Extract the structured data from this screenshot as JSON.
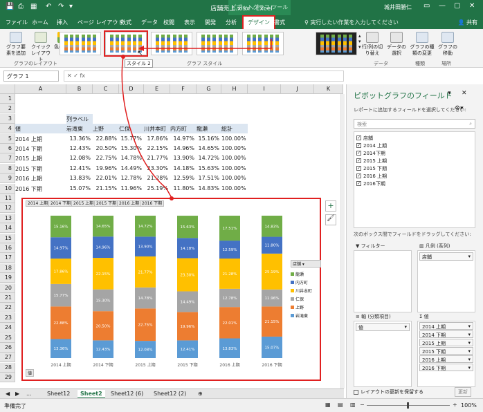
{
  "titlebar": {
    "title": "店舗売上.xlsx - Excel",
    "context_tool": "ピボットグラフ ツール",
    "user": "城井田勝仁"
  },
  "tabs": [
    "ファイル",
    "ホーム",
    "挿入",
    "ページ レイアウト",
    "数式",
    "データ",
    "校閲",
    "表示",
    "開発",
    "分析",
    "デザイン",
    "書式"
  ],
  "tellme": "実行したい作業を入力してください",
  "share": "共有",
  "ribbon": {
    "add_element": "グラフ要素を追加",
    "quick_layout": "クイックレイアウト",
    "change_color": "色の変更",
    "switch_row_col": "行/列の切り替え",
    "select_data": "データの選択",
    "change_type": "グラフの種類の変更",
    "move_chart": "グラフの移動",
    "group_layout": "グラフのレイアウト",
    "group_style": "グラフ スタイル",
    "group_data": "データ",
    "group_type": "種類",
    "group_location": "場所",
    "tooltip": "スタイル 2"
  },
  "namebox": "グラフ 1",
  "columns": [
    "A",
    "B",
    "C",
    "D",
    "E",
    "F",
    "G",
    "H",
    "I",
    "J",
    "K"
  ],
  "rows": [
    "1",
    "2",
    "3",
    "4",
    "5",
    "6",
    "7",
    "8",
    "9",
    "10",
    "11",
    "12",
    "13",
    "14",
    "15",
    "16",
    "17",
    "18",
    "19",
    "20",
    "21",
    "22",
    "23",
    "24",
    "25",
    "26",
    "27",
    "28",
    "29"
  ],
  "pivot": {
    "col_label": "列ラベル",
    "value_header": "値",
    "headers": [
      "岩滝東",
      "上野",
      "仁保",
      "川井本町",
      "内方町",
      "龍瀬",
      "総計"
    ],
    "rows": [
      {
        "label": "2014 上期",
        "values": [
          "13.36%",
          "22.88%",
          "15.77%",
          "17.86%",
          "14.97%",
          "15.16%",
          "100.00%"
        ]
      },
      {
        "label": "2014 下期",
        "values": [
          "12.43%",
          "20.50%",
          "15.30%",
          "22.15%",
          "14.96%",
          "14.65%",
          "100.00%"
        ]
      },
      {
        "label": "2015 上期",
        "values": [
          "12.08%",
          "22.75%",
          "14.78%",
          "21.77%",
          "13.90%",
          "14.72%",
          "100.00%"
        ]
      },
      {
        "label": "2015 下期",
        "values": [
          "12.41%",
          "19.96%",
          "14.49%",
          "23.30%",
          "14.18%",
          "15.63%",
          "100.00%"
        ]
      },
      {
        "label": "2016 上期",
        "values": [
          "13.83%",
          "22.01%",
          "12.78%",
          "21.28%",
          "12.59%",
          "17.51%",
          "100.00%"
        ]
      },
      {
        "label": "2016 下期",
        "values": [
          "15.07%",
          "21.15%",
          "11.96%",
          "25.19%",
          "11.80%",
          "14.83%",
          "100.00%"
        ]
      }
    ]
  },
  "chart_data": {
    "type": "bar",
    "stacked": "percent",
    "categories": [
      "2014 上期",
      "2014 下期",
      "2015 上期",
      "2015 下期",
      "2016 上期",
      "2016 下期"
    ],
    "series": [
      {
        "name": "岩滝東",
        "color": "#5b9bd5",
        "values": [
          13.36,
          12.43,
          12.08,
          12.41,
          13.83,
          15.07
        ]
      },
      {
        "name": "上野",
        "color": "#ed7d31",
        "values": [
          22.88,
          20.5,
          22.75,
          19.96,
          22.01,
          21.15
        ]
      },
      {
        "name": "仁保",
        "color": "#a5a5a5",
        "values": [
          15.77,
          15.3,
          14.78,
          14.49,
          12.78,
          11.96
        ]
      },
      {
        "name": "川井本町",
        "color": "#ffc000",
        "values": [
          17.86,
          22.15,
          21.77,
          23.3,
          21.28,
          25.19
        ]
      },
      {
        "name": "内方町",
        "color": "#4472c4",
        "values": [
          14.97,
          14.96,
          13.9,
          14.18,
          12.59,
          11.8
        ]
      },
      {
        "name": "龍瀬",
        "color": "#70ad47",
        "values": [
          15.16,
          14.65,
          14.72,
          15.63,
          17.51,
          14.83
        ]
      }
    ],
    "legend_title": "店舗",
    "legend_position": "right",
    "filter_label": "値",
    "grid": false
  },
  "field_buttons": [
    "2014 上期",
    "2014 下期",
    "2015 上期",
    "2015 下期",
    "2016 上期",
    "2016 下期"
  ],
  "pane": {
    "title": "ピボットグラフのフィールド",
    "subtitle": "レポートに追加するフィールドを選択してください:",
    "search": "検索",
    "fields": [
      "店舗",
      "2014 上期",
      "2014下期",
      "2015 上期",
      "2015 下期",
      "2016 上期",
      "2016下期"
    ],
    "drag_hint": "次のボックス間でフィールドをドラッグしてください:",
    "filter_area": "フィルター",
    "legend_area": "凡例 (系列)",
    "legend_item": "店舗",
    "axis_area": "軸 (分類項目)",
    "axis_item": "値",
    "values_area": "値",
    "values_items": [
      "2014 上期",
      "2014 下期",
      "2015 上期",
      "2015 下期",
      "2016 上期",
      "2016 下期"
    ],
    "defer": "レイアウトの更新を保留する",
    "update": "更新"
  },
  "sheets": [
    "Sheet12",
    "Sheet2",
    "Sheet12 (6)",
    "Sheet12 (2)"
  ],
  "active_sheet": "Sheet2",
  "status": {
    "ready": "準備完了",
    "zoom": "100%"
  }
}
